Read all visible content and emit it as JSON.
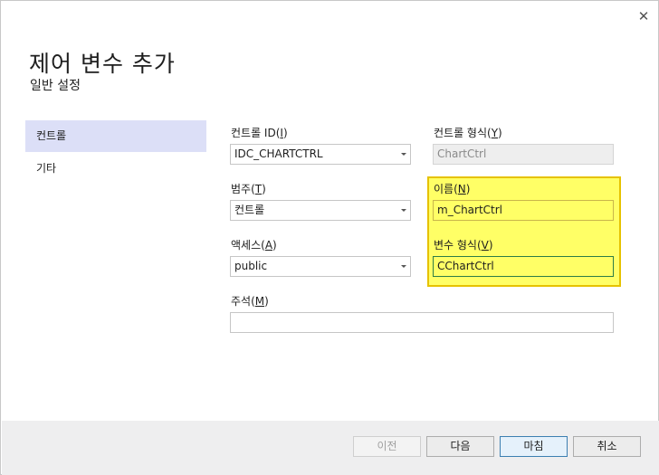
{
  "window": {
    "title": "제어 변수 추가",
    "subtitle": "일반 설정",
    "close_glyph": "✕"
  },
  "sidebar": {
    "items": [
      {
        "label": "컨트롤",
        "selected": true
      },
      {
        "label": "기타",
        "selected": false
      }
    ]
  },
  "form": {
    "control_id": {
      "label": "컨트롤 ID(",
      "accel": "I",
      "label_end": ")",
      "value": "IDC_CHARTCTRL"
    },
    "control_type": {
      "label": "컨트롤 형식(",
      "accel": "Y",
      "label_end": ")",
      "value": "ChartCtrl"
    },
    "category": {
      "label": "범주(",
      "accel": "T",
      "label_end": ")",
      "value": "컨트롤"
    },
    "name": {
      "label": "이름(",
      "accel": "N",
      "label_end": ")",
      "value": "m_ChartCtrl"
    },
    "access": {
      "label": "액세스(",
      "accel": "A",
      "label_end": ")",
      "value": "public"
    },
    "variable_type": {
      "label": "변수 형식(",
      "accel": "V",
      "label_end": ")",
      "value": "CChartCtrl"
    },
    "comment": {
      "label": "주석(",
      "accel": "M",
      "label_end": ")",
      "value": ""
    }
  },
  "footer": {
    "prev_label": "이전",
    "next_label": "다음",
    "finish_label": "마침",
    "cancel_label": "취소"
  },
  "colors": {
    "highlight": "#ffff66",
    "highlight_border": "#e6c200",
    "selected_nav": "#dcdff7",
    "footer_bg": "#eeeeef"
  }
}
